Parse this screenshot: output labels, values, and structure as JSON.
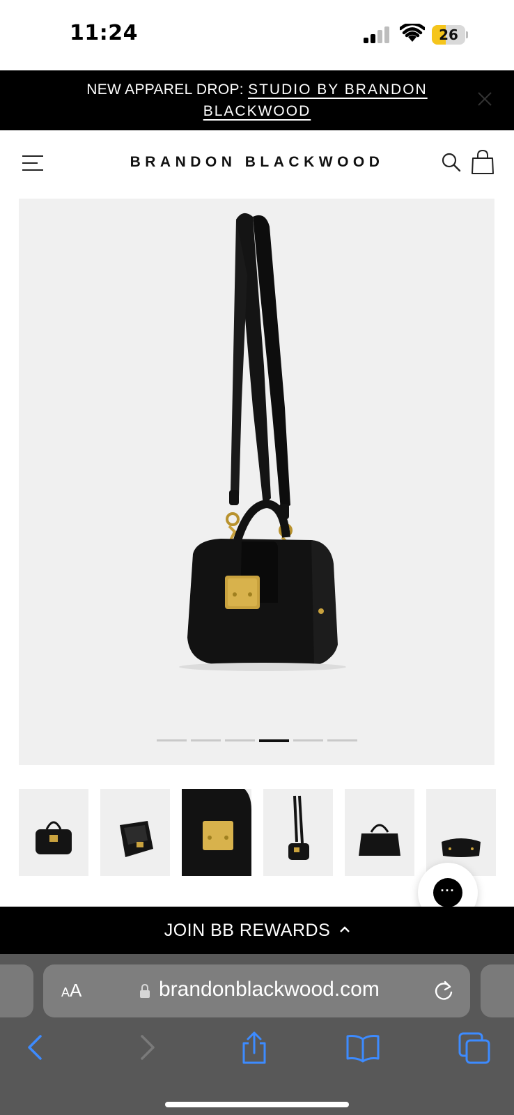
{
  "status_bar": {
    "time": "11:24",
    "battery_level": "26",
    "battery_fraction": 0.26,
    "battery_color": "#f5c51c"
  },
  "announcement": {
    "prefix": "NEW APPAREL DROP: ",
    "link_line1": "STUDIO BY BRANDON",
    "link_line2": "BLACKWOOD",
    "close_icon": "close-icon"
  },
  "header": {
    "menu_icon": "hamburger-menu-icon",
    "brand": "BRANDON BLACKWOOD",
    "search_icon": "search-icon",
    "cart_icon": "shopping-bag-icon"
  },
  "gallery": {
    "background": "#f0f0f0",
    "slide_count": 6,
    "active_slide_index": 3,
    "thumbnail_count": 6,
    "active_thumbnail_index": 2
  },
  "chat": {
    "icon": "chat-bubble-icon",
    "glyph": "···"
  },
  "rewards": {
    "label": "JOIN BB REWARDS",
    "icon": "chevron-up-icon"
  },
  "browser": {
    "text_size_label_small": "A",
    "text_size_label_large": "A",
    "url": "brandonblackwood.com",
    "lock_icon": "lock-icon",
    "reload_icon": "reload-icon",
    "accent": "#3d8bff",
    "toolbar": [
      "back-icon",
      "forward-icon",
      "share-icon",
      "bookmarks-icon",
      "tabs-icon"
    ]
  }
}
